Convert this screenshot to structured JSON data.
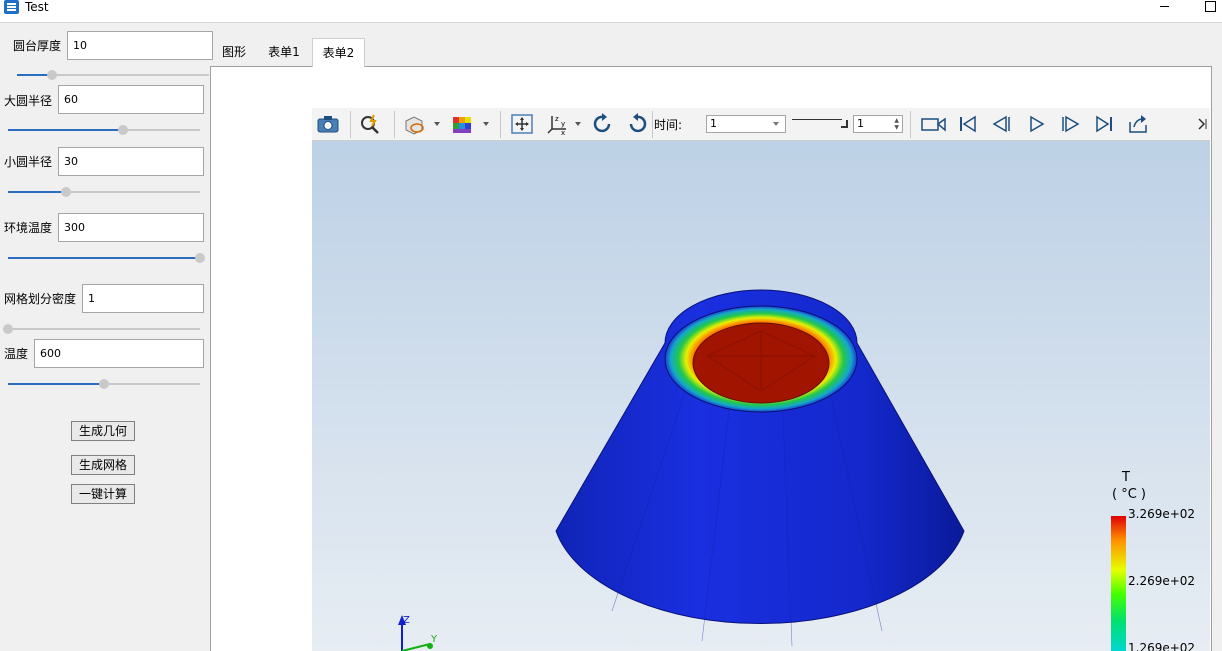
{
  "window": {
    "title": "Test"
  },
  "params": [
    {
      "label": "圆台厚度",
      "value": "10",
      "slider": 0.18
    },
    {
      "label": "大圆半径",
      "value": "60",
      "slider": 0.6
    },
    {
      "label": "小圆半径",
      "value": "30",
      "slider": 0.3
    },
    {
      "label": "环境温度",
      "value": "300",
      "slider": 1.0
    },
    {
      "label": "网格划分密度",
      "value": "1",
      "slider": 0.0
    },
    {
      "label": "温度",
      "value": "600",
      "slider": 0.5
    }
  ],
  "buttons": {
    "geometry": "生成几何",
    "mesh": "生成网格",
    "compute": "一键计算"
  },
  "tabs": [
    {
      "label": "图形",
      "active": false
    },
    {
      "label": "表单1",
      "active": false
    },
    {
      "label": "表单2",
      "active": true
    }
  ],
  "toolbar": {
    "icons": [
      "camera-icon",
      "query-icon",
      "display-mode-icon",
      "color-map-icon",
      "fit-view-icon",
      "axes-icon",
      "rotate-cw-icon",
      "rotate-ccw-icon",
      "record-icon",
      "first-frame-icon",
      "prev-frame-icon",
      "play-icon",
      "next-frame-icon",
      "last-frame-icon",
      "export-icon"
    ],
    "time_label": "时间:",
    "time_value": "1",
    "frame_value": "1"
  },
  "viewport": {
    "legend_title": "T",
    "legend_unit": "( °C )",
    "legend_ticks": [
      "3.269e+02",
      "2.269e+02",
      "1.269e+02"
    ],
    "colors": {
      "cold": "#1a2fe0",
      "hot": "#c01800",
      "background_top": "#bdd1e6",
      "background_bottom": "#e7edf3"
    },
    "axis_labels": {
      "z": "Z",
      "y": "Y"
    }
  }
}
